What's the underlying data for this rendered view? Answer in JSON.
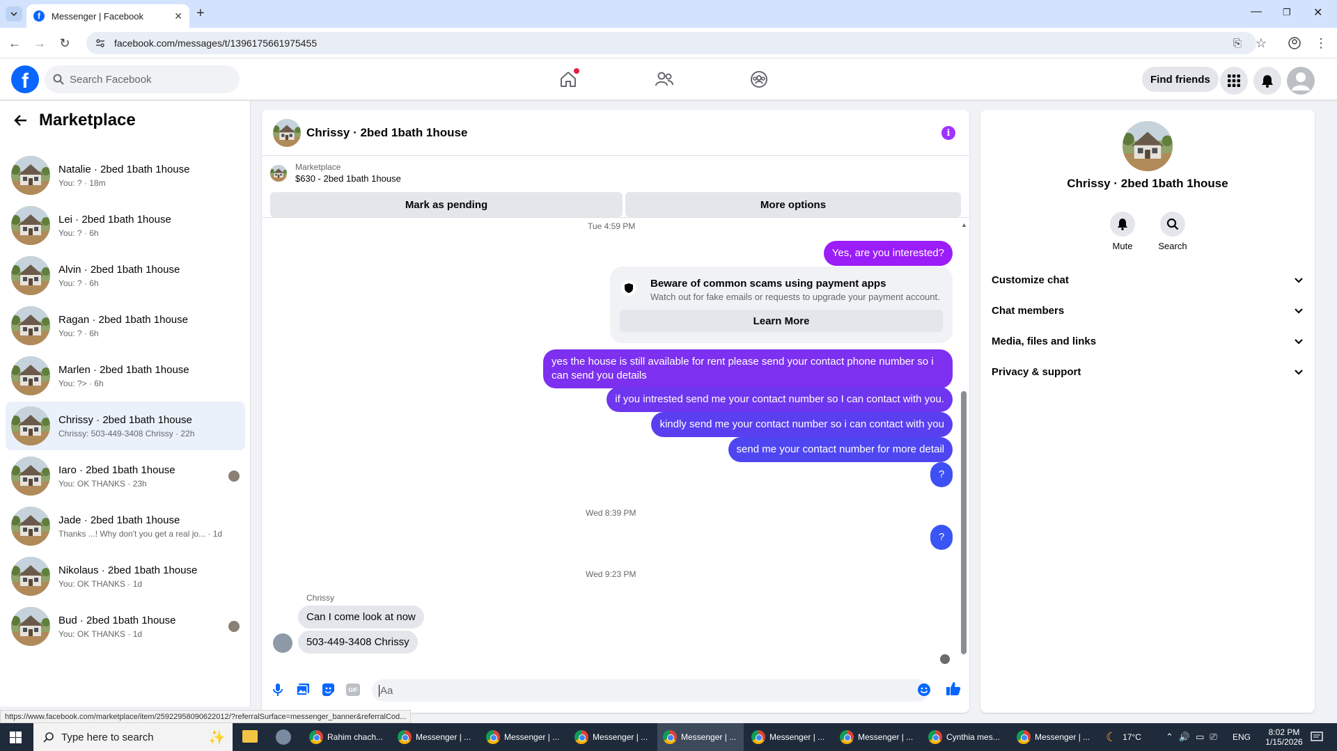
{
  "browser": {
    "tab_title": "Messenger | Facebook",
    "url": "facebook.com/messages/t/1396175661975455",
    "status_url": "https://www.facebook.com/marketplace/item/25922958090622012/?referralSurface=messenger_banner&referralCod..."
  },
  "fb": {
    "logo": "f",
    "search_placeholder": "Search Facebook",
    "find_friends": "Find friends"
  },
  "sidebar": {
    "title": "Marketplace",
    "items": [
      {
        "name": "Natalie · 2bed 1bath 1house",
        "sub": "You: ? · 18m"
      },
      {
        "name": "Lei · 2bed 1bath 1house",
        "sub": "You: ? · 6h"
      },
      {
        "name": "Alvin · 2bed 1bath 1house",
        "sub": "You: ? · 6h"
      },
      {
        "name": "Ragan · 2bed 1bath 1house",
        "sub": "You: ? · 6h"
      },
      {
        "name": "Marlen · 2bed 1bath 1house",
        "sub": "You: ?> · 6h"
      },
      {
        "name": "Chrissy · 2bed 1bath 1house",
        "sub": "Chrissy: 503-449-3408 Chrissy · 22h"
      },
      {
        "name": "Iaro · 2bed 1bath 1house",
        "sub": "You: OK THANKS · 23h"
      },
      {
        "name": "Jade · 2bed 1bath 1house",
        "sub": "Thanks ...! Why don't you get a real jo... · 1d"
      },
      {
        "name": "Nikolaus · 2bed 1bath 1house",
        "sub": "You: OK THANKS · 1d"
      },
      {
        "name": "Bud · 2bed 1bath 1house",
        "sub": "You: OK THANKS · 1d"
      }
    ]
  },
  "chat": {
    "title": "Chrissy · 2bed 1bath 1house",
    "info_icon": "i",
    "banner_label": "Marketplace",
    "banner_item": "$630 - 2bed 1bath 1house",
    "mark_pending": "Mark as pending",
    "more_options": "More options",
    "ts1": "Tue 4:59 PM",
    "ts2": "Wed 8:39 PM",
    "ts3": "Wed 9:23 PM",
    "out1": "Yes, are you interested?",
    "scam_title": "Beware of common scams using payment apps",
    "scam_sub": "Watch out for fake emails or requests to upgrade your payment account.",
    "learn_more": "Learn More",
    "out2": "yes the house is still available for rent please send your contact phone number so i can send you details",
    "out3": "if you intrested send me your contact number so I can contact with you.",
    "out4": "kindly send me your contact number so i can contact with you",
    "out5": "send me your contact number for more detail",
    "out6": "?",
    "out7": "?",
    "sender": "Chrissy",
    "in1": "Can I come look at now",
    "in2": "503-449-3408 Chrissy",
    "composer_placeholder": "Aa",
    "gif_label": "GIF"
  },
  "info_panel": {
    "name": "Chrissy · 2bed 1bath 1house",
    "mute": "Mute",
    "search": "Search",
    "sections": [
      "Customize chat",
      "Chat members",
      "Media, files and links",
      "Privacy & support"
    ]
  },
  "taskbar": {
    "search_placeholder": "Type here to search",
    "apps": [
      "Rahim chach...",
      "Messenger | ...",
      "Messenger | ...",
      "Messenger | ...",
      "Messenger | ...",
      "Messenger | ...",
      "Messenger | ...",
      "Cynthia mes...",
      "Messenger | ..."
    ],
    "temperature": "17°C",
    "lang": "ENG",
    "time": "8:02 PM",
    "date": "1/15/2026"
  },
  "colors": {
    "fb_blue": "#0866ff",
    "accent_purple": "#a033ff",
    "notification_red": "#e41e3f"
  }
}
